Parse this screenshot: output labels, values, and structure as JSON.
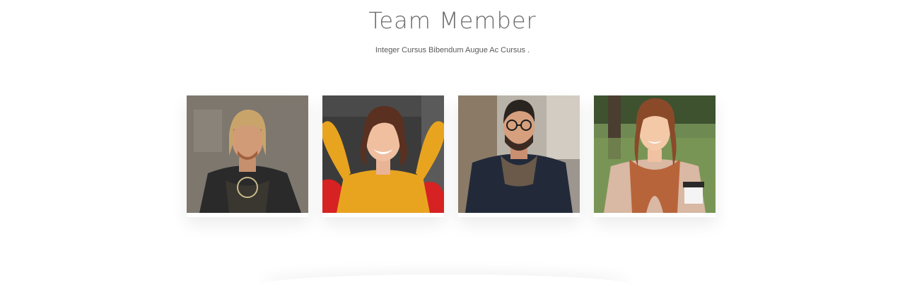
{
  "section": {
    "title": "Team Member",
    "subtitle": "Integer Cursus Bibendum Augue Ac Cursus ."
  },
  "members": [
    {
      "photo_icon": "man-long-hair-photo",
      "background": "#7a756c",
      "shirt": "#2a2a2a"
    },
    {
      "photo_icon": "woman-yellow-shirt-photo",
      "background": "#3b3b3b",
      "shirt": "#e8a41f"
    },
    {
      "photo_icon": "man-glasses-jacket-photo",
      "background": "#a9a39a",
      "shirt": "#222a3a"
    },
    {
      "photo_icon": "woman-scarf-coffee-photo",
      "background": "#5d7a44",
      "shirt": "#d9b8a4"
    }
  ]
}
